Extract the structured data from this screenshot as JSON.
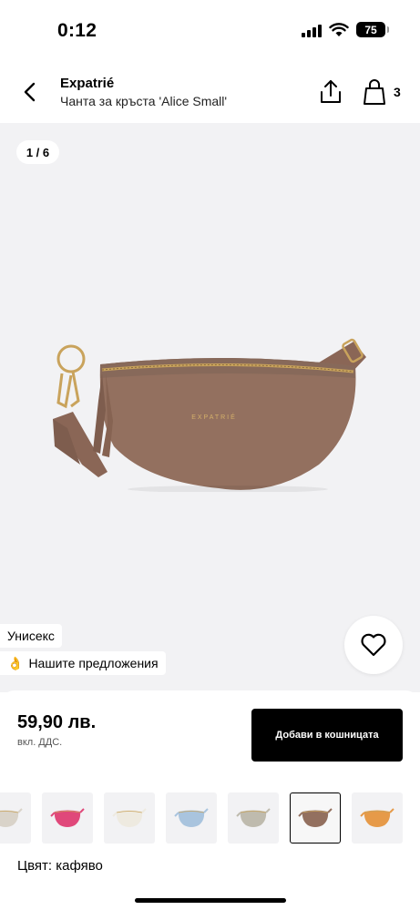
{
  "status_bar": {
    "time": "0:12",
    "battery": "75"
  },
  "header": {
    "brand": "Expatrié",
    "product_name": "Чанта за кръста 'Alice Small'",
    "cart_count": "3"
  },
  "gallery": {
    "counter": "1 / 6",
    "logo_text": "EXPATRIÉ",
    "bag_color": "#93705f"
  },
  "tags": {
    "unisex": "Унисекс",
    "offers_icon": "👌",
    "offers": "Нашите предложения"
  },
  "purchase": {
    "price": "59,90 лв.",
    "price_note": "вкл. ДДС.",
    "add_to_cart": "Добави в кошницата"
  },
  "swatches": [
    {
      "name": "beige",
      "color": "#d9d3c9"
    },
    {
      "name": "pink",
      "color": "#e0487a"
    },
    {
      "name": "cream",
      "color": "#eeeae0"
    },
    {
      "name": "light-blue",
      "color": "#a9c4de"
    },
    {
      "name": "sage",
      "color": "#bfbbae"
    },
    {
      "name": "brown",
      "color": "#93705f",
      "selected": true
    },
    {
      "name": "orange",
      "color": "#e69a49"
    }
  ],
  "color_label": "Цвят: кафяво"
}
